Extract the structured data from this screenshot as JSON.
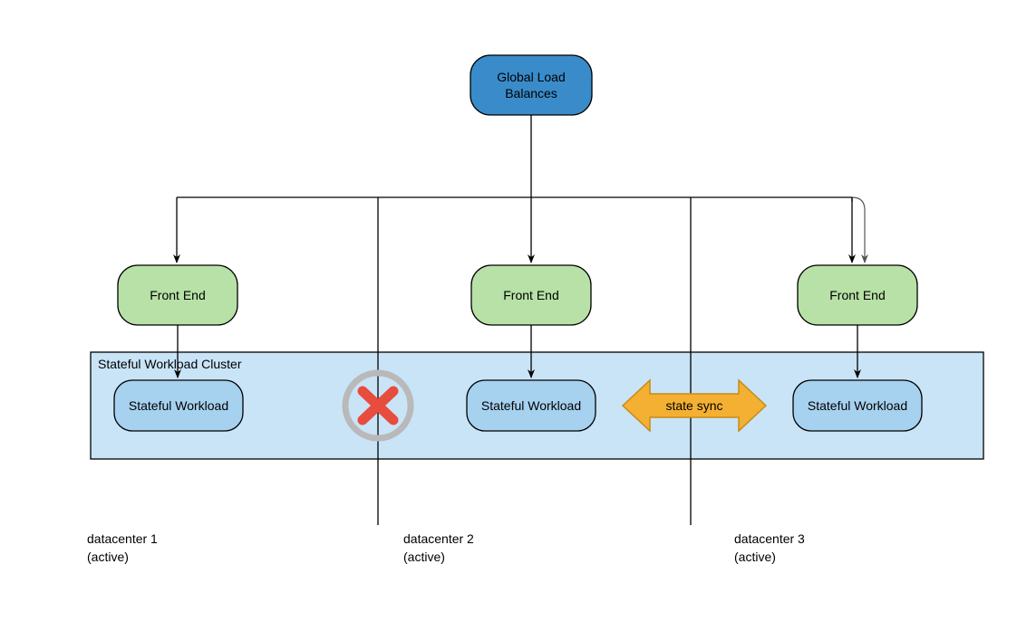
{
  "colors": {
    "blue_fill": "#3a8bc9",
    "blue_stroke": "#000000",
    "green_fill": "#b7e1a6",
    "green_stroke": "#000000",
    "light_blue_fill": "#a6d1ef",
    "light_blue_stroke": "#000000",
    "cluster_fill": "#c9e4f7",
    "cluster_stroke": "#000000",
    "arrow_orange_fill": "#f4b032",
    "arrow_orange_stroke": "#c78a17",
    "x_color": "#e84c3d",
    "ring_color": "#b9b9b9"
  },
  "nodes": {
    "global_lb": {
      "line1": "Global Load",
      "line2": "Balances"
    },
    "front_end_1": "Front End",
    "front_end_2": "Front End",
    "front_end_3": "Front End",
    "stateful_1": "Stateful Workload",
    "stateful_2": "Stateful Workload",
    "stateful_3": "Stateful Workload"
  },
  "cluster_label": "Stateful Workload Cluster",
  "state_sync_label": "state sync",
  "datacenters": {
    "dc1": {
      "line1": "datacenter 1",
      "line2": "(active)"
    },
    "dc2": {
      "line1": "datacenter 2",
      "line2": "(active)"
    },
    "dc3": {
      "line1": "datacenter 3",
      "line2": "(active)"
    }
  }
}
